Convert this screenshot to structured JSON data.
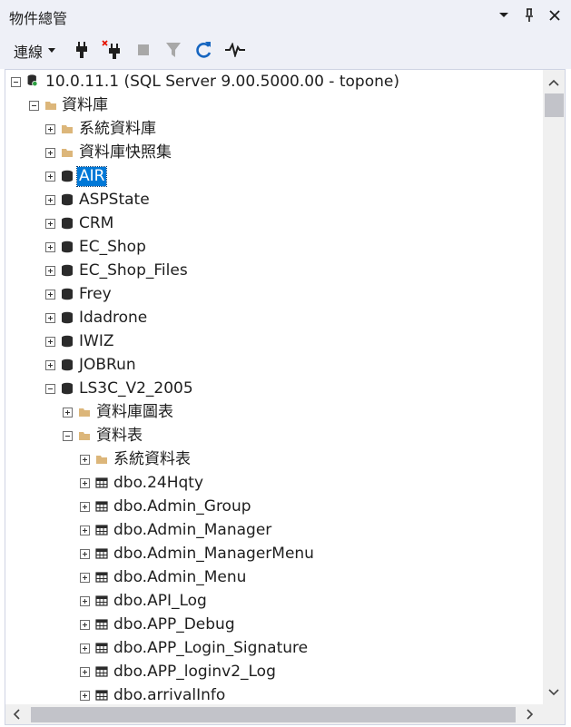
{
  "window": {
    "title": "物件總管"
  },
  "toolbar": {
    "connect_label": "連線"
  },
  "tree": {
    "server": "10.0.11.1 (SQL Server 9.00.5000.00 - topone)",
    "databases_folder": "資料庫",
    "system_databases": "系統資料庫",
    "snapshots": "資料庫快照集",
    "databases": [
      "AIR",
      "ASPState",
      "CRM",
      "EC_Shop",
      "EC_Shop_Files",
      "Frey",
      "Idadrone",
      "IWIZ",
      "JOBRun",
      "LS3C_V2_2005"
    ],
    "selected_database": "AIR",
    "db_diagrams": "資料庫圖表",
    "tables_folder": "資料表",
    "system_tables": "系統資料表",
    "tables": [
      "dbo.24Hqty",
      "dbo.Admin_Group",
      "dbo.Admin_Manager",
      "dbo.Admin_ManagerMenu",
      "dbo.Admin_Menu",
      "dbo.API_Log",
      "dbo.APP_Debug",
      "dbo.APP_Login_Signature",
      "dbo.APP_loginv2_Log",
      "dbo.arrivalInfo"
    ]
  },
  "colors": {
    "selection": "#0078d7",
    "folder": "#dcb67a",
    "chrome": "#eef0f7"
  }
}
